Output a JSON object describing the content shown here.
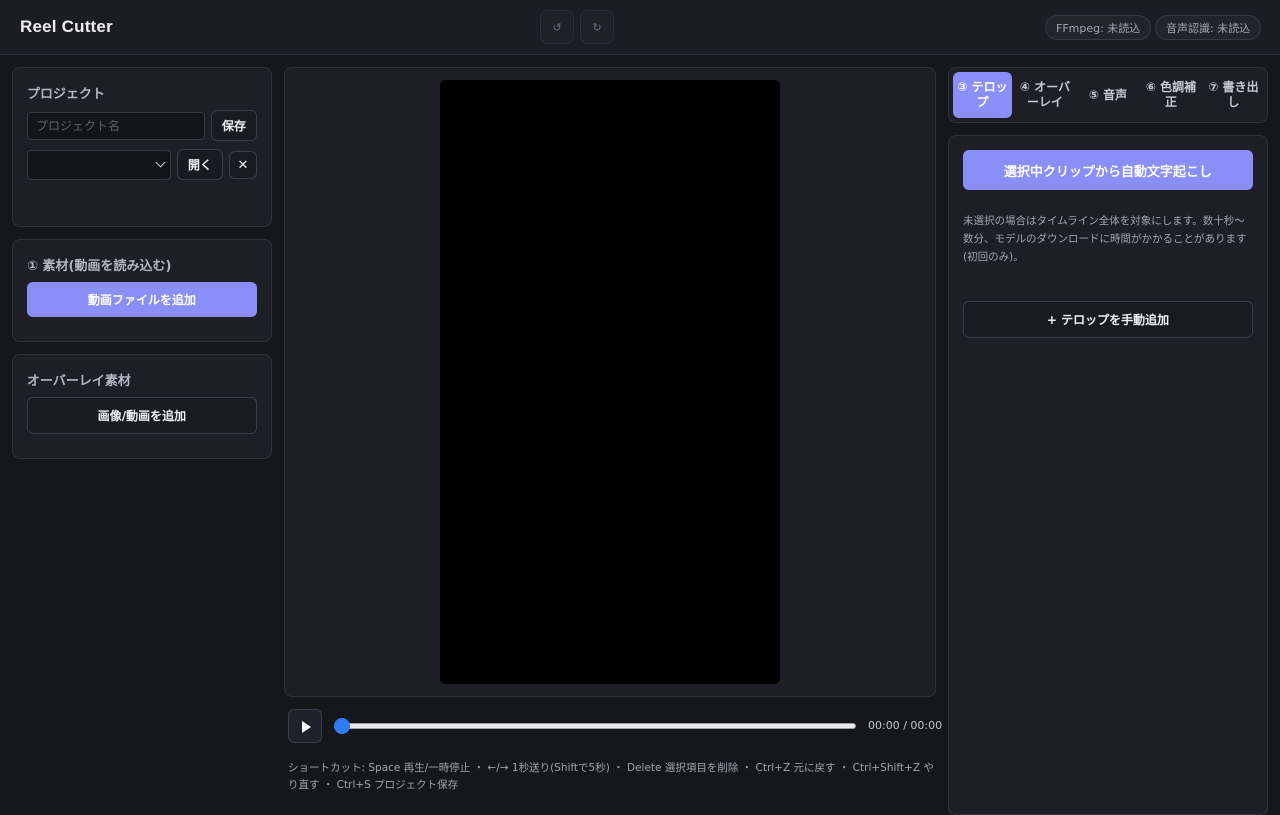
{
  "header": {
    "title": "Reel Cutter",
    "undo_icon": "↺",
    "redo_icon": "↻",
    "status_ffmpeg": "FFmpeg: 未読込",
    "status_speech": "音声認識: 未読込"
  },
  "project": {
    "title": "プロジェクト",
    "name_placeholder": "プロジェクト名",
    "save_label": "保存",
    "open_label": "開く",
    "close_icon": "✕"
  },
  "media": {
    "title": "① 素材(動画を読み込む)",
    "add_video_label": "動画ファイルを追加"
  },
  "overlay_media": {
    "title": "オーバーレイ素材",
    "add_label": "画像/動画を追加"
  },
  "player": {
    "time": "00:00 / 00:00",
    "progress": 0,
    "shortcuts": "ショートカット: Space 再生/一時停止 ・ ←/→ 1秒送り(Shiftで5秒) ・ Delete 選択項目を削除 ・ Ctrl+Z 元に戻す ・ Ctrl+Shift+Z やり直す ・ Ctrl+S プロジェクト保存"
  },
  "tabs": [
    {
      "label": "③ テロップ",
      "active": true
    },
    {
      "label": "④ オーバーレイ",
      "active": false
    },
    {
      "label": "⑤ 音声",
      "active": false
    },
    {
      "label": "⑥ 色調補正",
      "active": false
    },
    {
      "label": "⑦ 書き出し",
      "active": false
    }
  ],
  "telop": {
    "auto_transcribe_label": "選択中クリップから自動文字起こし",
    "info": "未選択の場合はタイムライン全体を対象にします。数十秒〜数分、モデルのダウンロードに時間がかかることがあります(初回のみ)。",
    "manual_add_label": "+ テロップを手動追加"
  },
  "colors": {
    "accent": "#8a8ff8",
    "background": "#16171d",
    "panel": "#1d1e26",
    "seek_knob": "#2e7cf6"
  }
}
